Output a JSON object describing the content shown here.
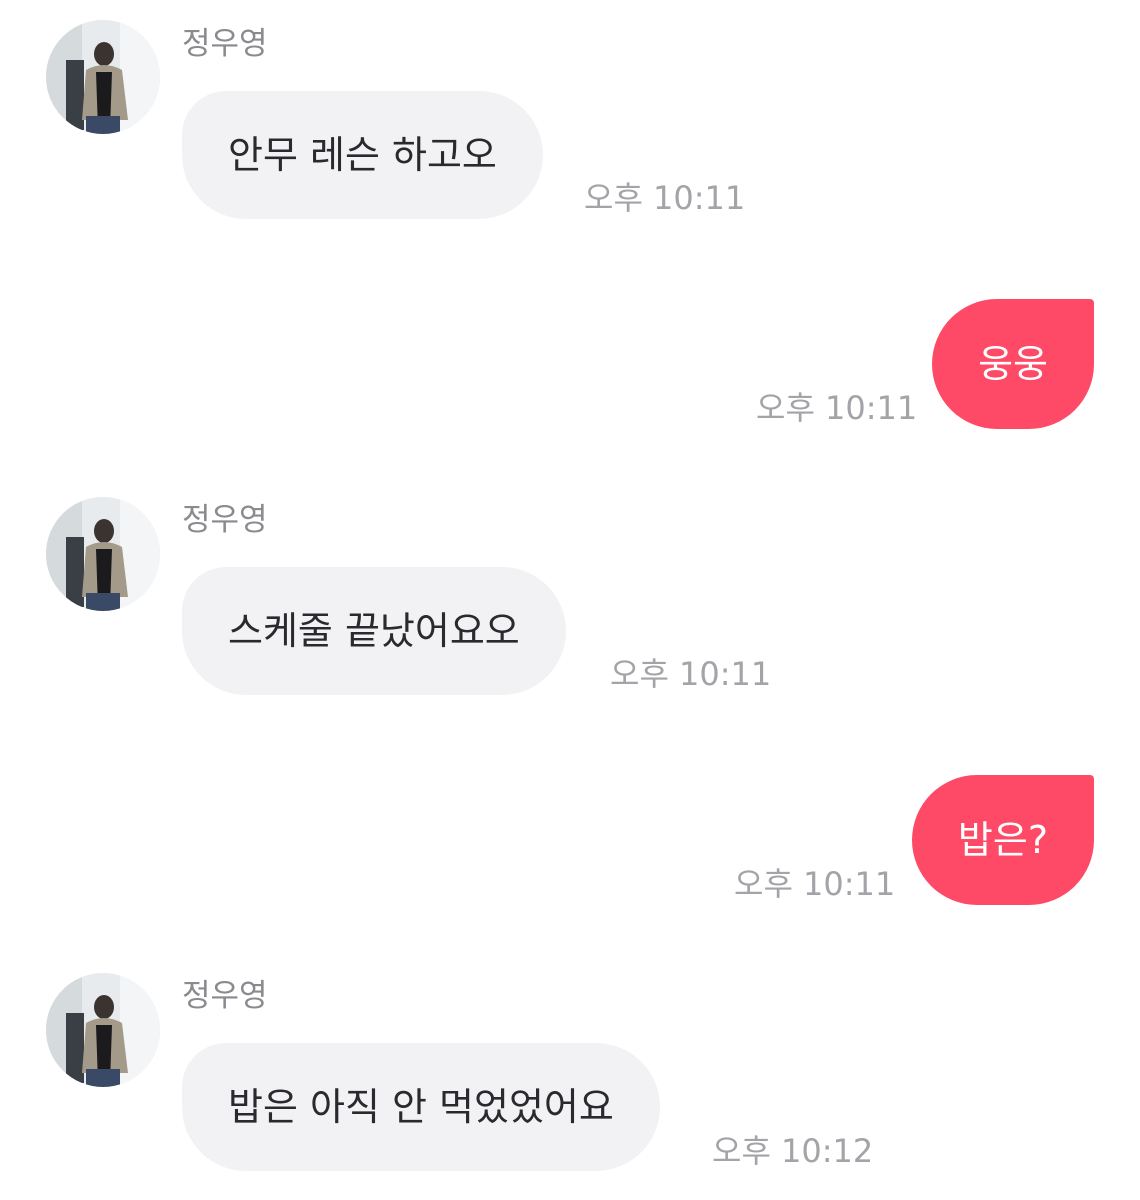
{
  "messages": [
    {
      "type": "in",
      "sender": "정우영",
      "text": "안무 레슨 하고오",
      "time": "오후 10:11"
    },
    {
      "type": "out",
      "text": "웅웅",
      "time": "오후 10:11"
    },
    {
      "type": "in",
      "sender": "정우영",
      "text": "스케줄 끝났어요오",
      "time": "오후 10:11"
    },
    {
      "type": "out",
      "text": "밥은?",
      "time": "오후 10:11"
    },
    {
      "type": "in",
      "sender": "정우영",
      "text": "밥은 아직 안 먹었었어요",
      "time": "오후 10:12"
    }
  ],
  "colors": {
    "incoming_bubble": "#f2f2f5",
    "outgoing_bubble": "#fe4a66",
    "timestamp": "#a3a3a8",
    "sender_name": "#8a8a8f"
  }
}
